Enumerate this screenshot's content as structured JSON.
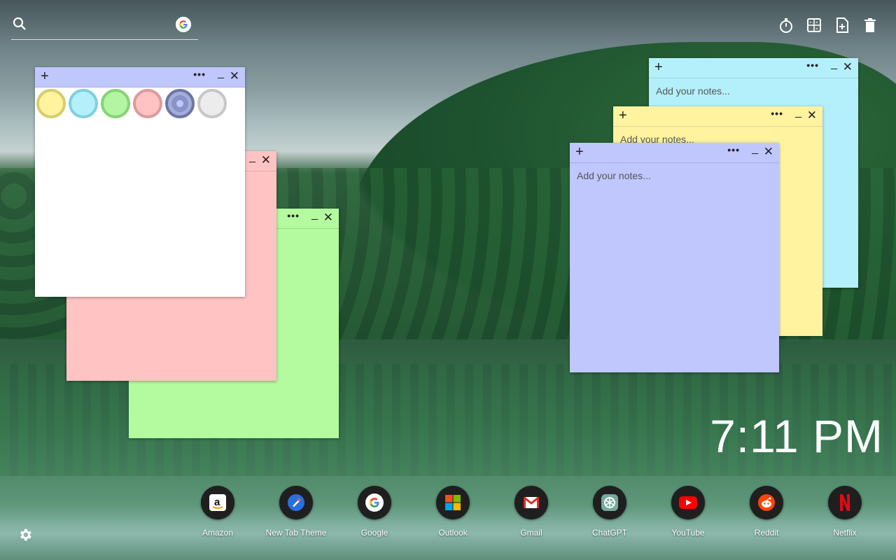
{
  "search": {
    "placeholder": ""
  },
  "toolbar": {
    "icons": [
      "timer-icon",
      "calculator-icon",
      "new-note-icon",
      "trash-icon"
    ]
  },
  "notes": {
    "placeholder": "Add your notes...",
    "bar": {
      "add": "+",
      "more": "•••",
      "minimize": "_",
      "close": "✕"
    },
    "palette": [
      {
        "name": "yellow",
        "fill": "#fff3a0",
        "border": "#d9cc6a"
      },
      {
        "name": "cyan",
        "fill": "#b3f0fb",
        "border": "#7ed0de"
      },
      {
        "name": "green",
        "fill": "#b3f5a3",
        "border": "#85d474"
      },
      {
        "name": "pink",
        "fill": "#ffc3c3",
        "border": "#dc9b9b"
      },
      {
        "name": "blue",
        "fill": "#8a93c8",
        "border": "#6c75a8"
      },
      {
        "name": "gray",
        "fill": "#ececec",
        "border": "#c7c7c7"
      }
    ]
  },
  "clock": {
    "time": "7:11 PM"
  },
  "dock": {
    "apps": [
      {
        "label": "Amazon"
      },
      {
        "label": "New Tab Theme"
      },
      {
        "label": "Google"
      },
      {
        "label": "Outlook"
      },
      {
        "label": "Gmail"
      },
      {
        "label": "ChatGPT"
      },
      {
        "label": "YouTube"
      },
      {
        "label": "Reddit"
      },
      {
        "label": "Netflix"
      }
    ]
  }
}
